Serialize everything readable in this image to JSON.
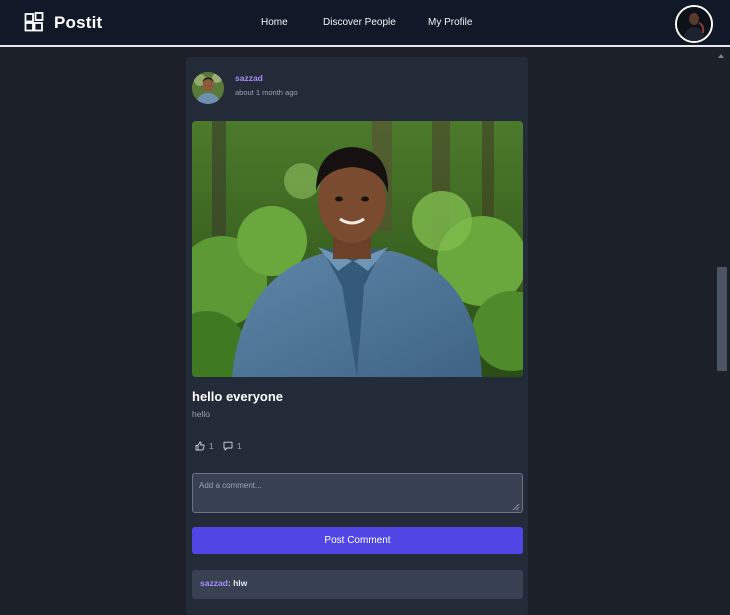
{
  "app": {
    "name": "Postit",
    "icon": "grid-logo-icon"
  },
  "nav": {
    "links": [
      {
        "label": "Home"
      },
      {
        "label": "Discover People"
      },
      {
        "label": "My Profile"
      }
    ],
    "profile_avatar": "user-avatar"
  },
  "post": {
    "author": "sazzad",
    "time": "about 1 month ago",
    "title": "hello everyone",
    "body": "hello",
    "likes": "1",
    "comments_count": "1",
    "image": "profile-photo"
  },
  "comment_form": {
    "placeholder": "Add a comment...",
    "value": "",
    "submit_label": "Post Comment"
  },
  "comments": [
    {
      "author": "sazzad",
      "separator": ":",
      "text": "hlw"
    }
  ],
  "colors": {
    "accent": "#4f46e5",
    "author": "#a78bfa",
    "background": "#1c2029",
    "card": "#232a38",
    "navbar": "#111827"
  }
}
